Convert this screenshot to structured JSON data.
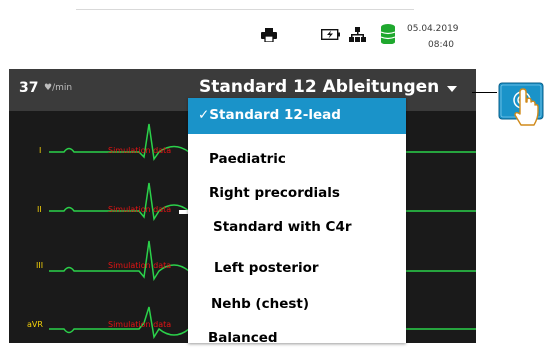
{
  "status_bar": {
    "date": "05.04.2019",
    "time": "08:40",
    "icons": [
      "printer-icon",
      "battery-charging-icon",
      "network-icon",
      "storage-icon"
    ]
  },
  "ecg": {
    "heart_rate": "37",
    "heart_rate_unit": "♥/min",
    "configuration_title": "Standard 12 Ableitungen",
    "leads": [
      "I",
      "II",
      "III",
      "aVR"
    ],
    "simulation_label": "Simulation data"
  },
  "dropdown": {
    "items": [
      {
        "label": "✓Standard 12-lead",
        "selected": true
      },
      {
        "label": "Paediatric",
        "selected": false
      },
      {
        "label": "Right precordials",
        "selected": false
      },
      {
        "label": "Standard with C4r",
        "selected": false
      },
      {
        "label": "Left posterior",
        "selected": false
      },
      {
        "label": "Nehb (chest)",
        "selected": false
      },
      {
        "label": "Balanced",
        "selected": false
      }
    ]
  },
  "colors": {
    "selected_item": "#1a93c9",
    "ecg_trace": "#2bd14a",
    "lead_label": "#f5d20a",
    "simulation_label": "#e21414",
    "touch_button": "#1a93c9"
  }
}
